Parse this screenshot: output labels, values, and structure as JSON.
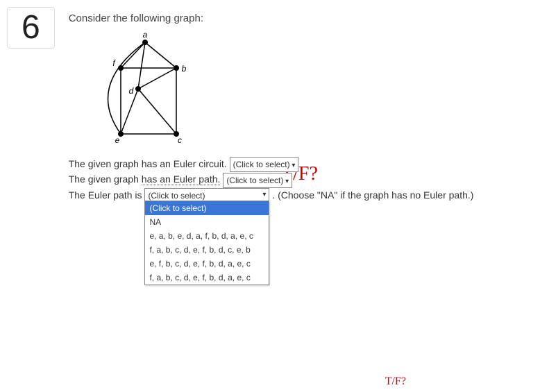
{
  "question_number": "6",
  "prompt": "Consider the following graph:",
  "graph": {
    "labels": {
      "a": "a",
      "b": "b",
      "c": "c",
      "d": "d",
      "e": "e",
      "f": "f"
    }
  },
  "annotations": {
    "tf1": "T/F?",
    "tf2": "T/F?"
  },
  "statements": {
    "circuit_text": "The given graph has an Euler circuit. ",
    "path_text_pre": "The given graph ",
    "path_text_link": "has an Euler path.",
    "euler_path_is": "The Euler path is",
    "hint": ". (Choose \"NA\" if the graph has no Euler path.)"
  },
  "selects": {
    "circuit_placeholder": "(Click to select)",
    "path_placeholder": "(Click to select)",
    "eulerpath_placeholder": "(Click to select)",
    "eulerpath_options": [
      "(Click to select)",
      "NA",
      "e, a, b, e, d, a, f, b, d, a, e, c",
      "f, a, b, c, d, e, f, b, d, c, e, b",
      "e, f, b, c, d, e, f, b, d, a, e, c",
      "f, a, b, c, d, e, f, b, d, a, e, c"
    ]
  }
}
